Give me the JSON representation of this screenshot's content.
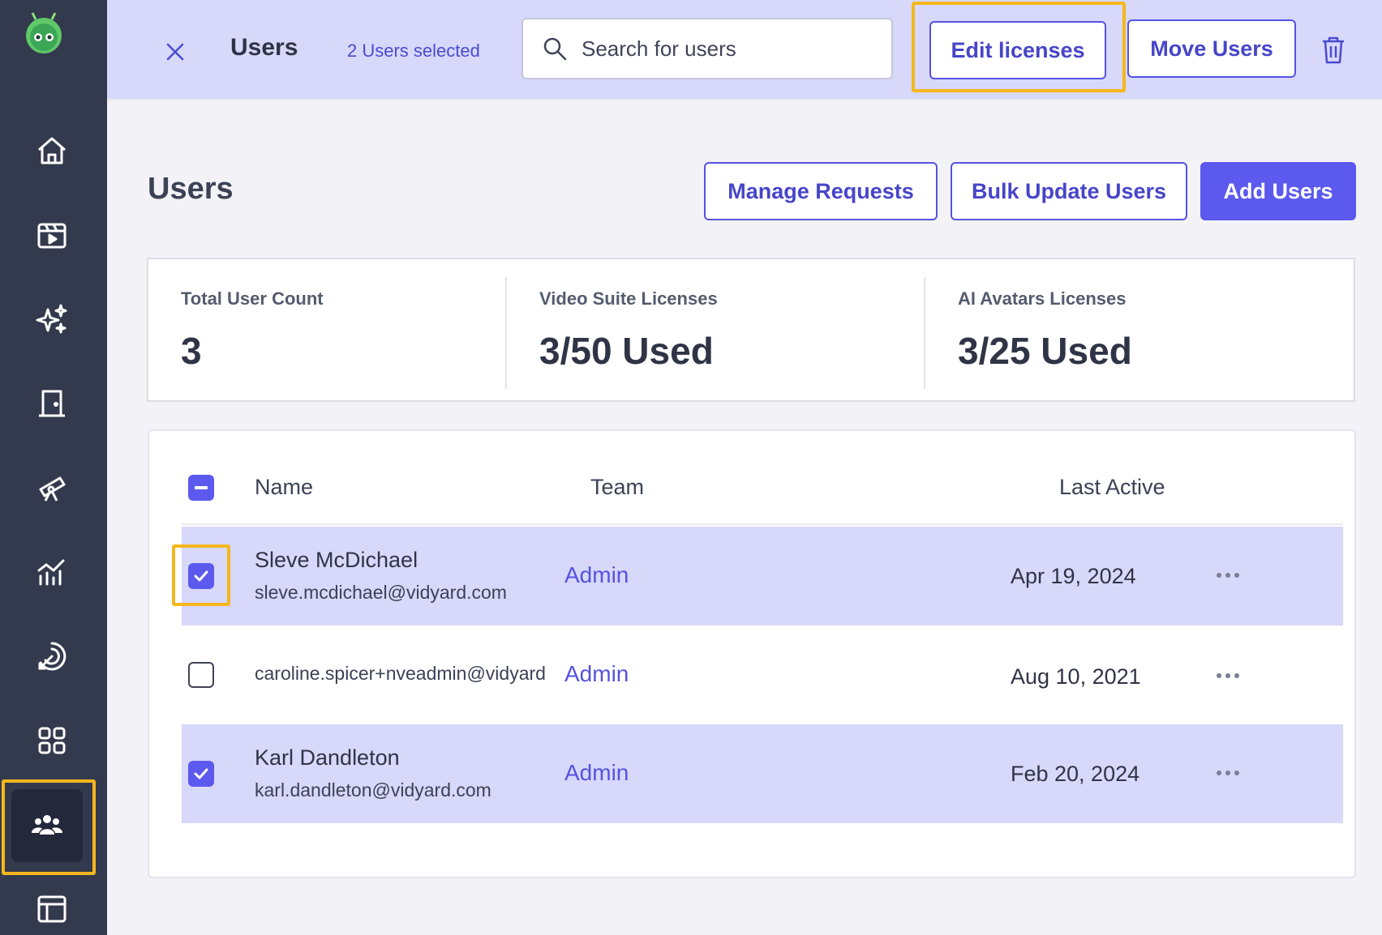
{
  "topbar": {
    "title": "Users",
    "selected_count": "2 Users selected",
    "search_placeholder": "Search for users",
    "edit_licenses_label": "Edit licenses",
    "move_users_label": "Move Users"
  },
  "main": {
    "title": "Users",
    "manage_requests_label": "Manage Requests",
    "bulk_update_label": "Bulk Update Users",
    "add_users_label": "Add Users"
  },
  "stats": [
    {
      "label": "Total User Count",
      "value": "3"
    },
    {
      "label": "Video Suite Licenses",
      "value": "3/50 Used"
    },
    {
      "label": "AI Avatars Licenses",
      "value": "3/25 Used"
    }
  ],
  "table": {
    "columns": {
      "name": "Name",
      "team": "Team",
      "last_active": "Last Active"
    },
    "rows": [
      {
        "name": "Sleve McDichael",
        "email": "sleve.mcdichael@vidyard.com",
        "team": "Admin",
        "last_active": "Apr 19, 2024",
        "selected": true
      },
      {
        "name": "",
        "email": "caroline.spicer+nveadmin@vidyard",
        "team": "Admin",
        "last_active": "Aug 10, 2021",
        "selected": false
      },
      {
        "name": "Karl Dandleton",
        "email": "karl.dandleton@vidyard.com",
        "team": "Admin",
        "last_active": "Feb 20, 2024",
        "selected": true
      }
    ]
  },
  "sidebar": {
    "items": [
      "home-icon",
      "video-library-icon",
      "sparkles-icon",
      "door-icon",
      "telescope-icon",
      "analytics-icon",
      "target-icon",
      "apps-grid-icon",
      "users-icon",
      "layout-icon"
    ],
    "active": "users-icon"
  },
  "colors": {
    "accent": "#5b59ee",
    "highlight": "#f4b71d",
    "sidebar": "#343a4d",
    "selected_row": "#d7d8fa"
  }
}
